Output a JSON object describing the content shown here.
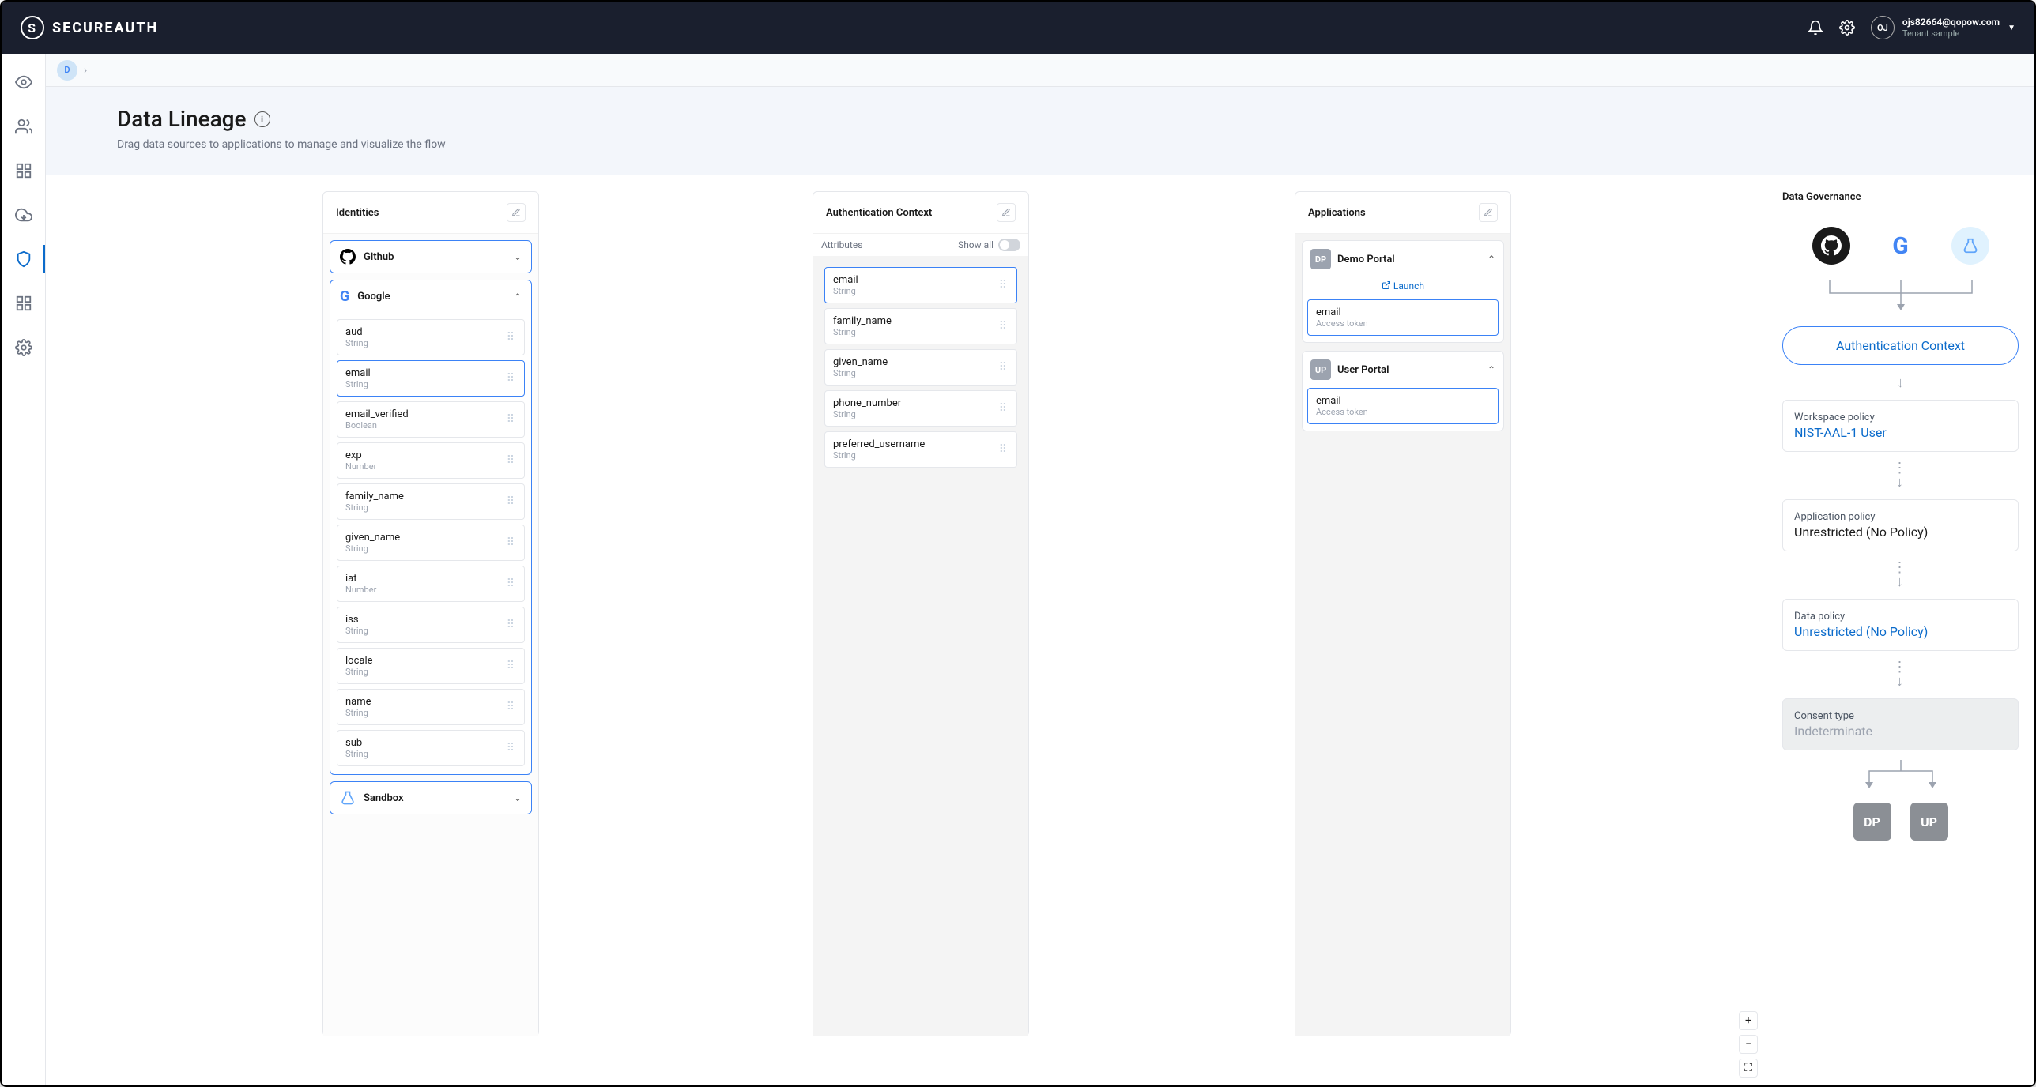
{
  "brand": "SECUREAUTH",
  "user": {
    "initials": "OJ",
    "email": "ojs82664@qopow.com",
    "tenant": "Tenant sample"
  },
  "breadcrumb": {
    "chip": "D"
  },
  "page": {
    "title": "Data Lineage",
    "subtitle": "Drag data sources to applications to manage and visualize the flow"
  },
  "columns": {
    "identities": {
      "title": "Identities",
      "providers": [
        {
          "id": "github",
          "label": "Github",
          "expanded": false
        },
        {
          "id": "google",
          "label": "Google",
          "expanded": true
        },
        {
          "id": "sandbox",
          "label": "Sandbox",
          "expanded": false
        }
      ]
    },
    "google_attrs": [
      {
        "name": "aud",
        "type": "String",
        "highlight": false
      },
      {
        "name": "email",
        "type": "String",
        "highlight": true
      },
      {
        "name": "email_verified",
        "type": "Boolean",
        "highlight": false
      },
      {
        "name": "exp",
        "type": "Number",
        "highlight": false
      },
      {
        "name": "family_name",
        "type": "String",
        "highlight": false
      },
      {
        "name": "given_name",
        "type": "String",
        "highlight": false
      },
      {
        "name": "iat",
        "type": "Number",
        "highlight": false
      },
      {
        "name": "iss",
        "type": "String",
        "highlight": false
      },
      {
        "name": "locale",
        "type": "String",
        "highlight": false
      },
      {
        "name": "name",
        "type": "String",
        "highlight": false
      },
      {
        "name": "sub",
        "type": "String",
        "highlight": false
      }
    ],
    "auth": {
      "title": "Authentication Context",
      "subhead": "Attributes",
      "show_all": "Show all",
      "attrs": [
        {
          "name": "email",
          "type": "String",
          "highlight": true
        },
        {
          "name": "family_name",
          "type": "String",
          "highlight": false
        },
        {
          "name": "given_name",
          "type": "String",
          "highlight": false
        },
        {
          "name": "phone_number",
          "type": "String",
          "highlight": false
        },
        {
          "name": "preferred_username",
          "type": "String",
          "highlight": false
        }
      ]
    },
    "apps": {
      "title": "Applications",
      "launch": "Launch",
      "items": [
        {
          "badge": "DP",
          "label": "Demo Portal",
          "attr": "email",
          "sub": "Access token",
          "launch": true
        },
        {
          "badge": "UP",
          "label": "User Portal",
          "attr": "email",
          "sub": "Access token",
          "launch": false
        }
      ]
    }
  },
  "governance": {
    "title": "Data Governance",
    "auth_context": "Authentication Context",
    "cards": [
      {
        "label": "Workspace policy",
        "value": "NIST-AAL-1 User",
        "blue": true
      },
      {
        "label": "Application policy",
        "value": "Unrestricted (No Policy)",
        "blue": false
      },
      {
        "label": "Data policy",
        "value": "Unrestricted (No Policy)",
        "blue": true
      }
    ],
    "consent": {
      "label": "Consent type",
      "value": "Indeterminate"
    },
    "badges": [
      "DP",
      "UP"
    ]
  }
}
